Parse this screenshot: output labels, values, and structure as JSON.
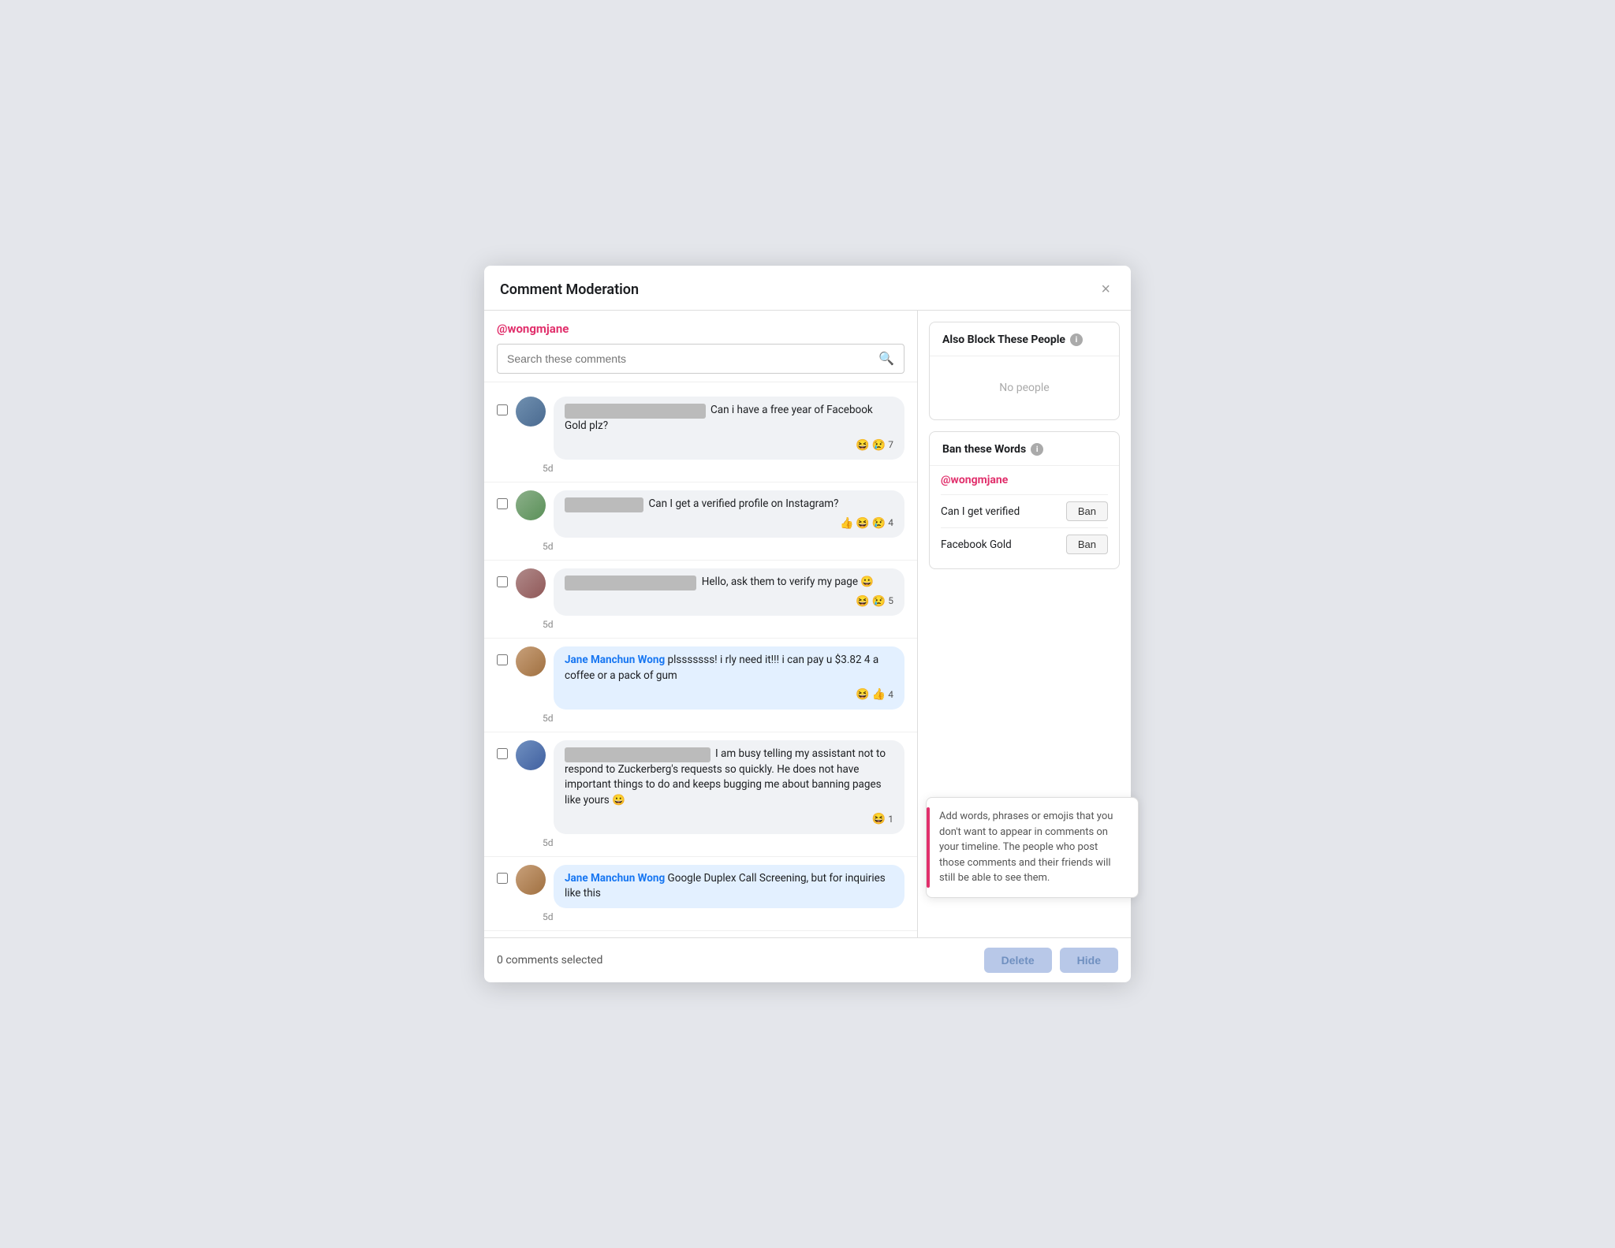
{
  "modal": {
    "title": "Comment Moderation",
    "close_label": "×"
  },
  "left": {
    "page_handle": "@wongmjane",
    "search_placeholder": "Search these comments",
    "comments": [
      {
        "id": 1,
        "blurred": true,
        "text": "Can i have a free year of Facebook Gold plz?",
        "reactions": [
          "😆",
          "😢"
        ],
        "reaction_count": 7,
        "time": "5d"
      },
      {
        "id": 2,
        "blurred": true,
        "text": "Can I get a verified profile on Instagram?",
        "reactions": [
          "👍",
          "😆",
          "😢"
        ],
        "reaction_count": 4,
        "time": "5d"
      },
      {
        "id": 3,
        "blurred": true,
        "text": "Hello, ask them to verify my page 😀",
        "reactions": [
          "😆",
          "😢"
        ],
        "reaction_count": 5,
        "time": "5d"
      },
      {
        "id": 4,
        "blurred": false,
        "name": "Jane Manchun Wong",
        "text": "plsssssss! i rly need it!!! i can pay u $3.82 4 a coffee or a pack of gum",
        "reactions": [
          "😆",
          "👍"
        ],
        "reaction_count": 4,
        "time": "5d"
      },
      {
        "id": 5,
        "blurred": true,
        "text": "I am busy telling my assistant not to respond to Zuckerberg's requests so quickly. He does not have important things to do and keeps bugging me about banning pages like yours 😀",
        "reactions": [
          "😆"
        ],
        "reaction_count": 1,
        "time": "5d"
      },
      {
        "id": 6,
        "blurred": false,
        "name": "Jane Manchun Wong",
        "text": "Google Duplex Call Screening, but for inquiries like this",
        "reactions": [],
        "reaction_count": 0,
        "time": "5d"
      }
    ]
  },
  "right": {
    "also_block": {
      "header": "Also Block These People",
      "no_people": "No people"
    },
    "ban_words": {
      "header": "Ban these Words",
      "handle": "@wongmjane",
      "words": [
        {
          "word": "Can I get verified",
          "btn": "Ban"
        },
        {
          "word": "Facebook Gold",
          "btn": "Ban"
        }
      ]
    },
    "tooltip": {
      "text": "Add words, phrases or emojis that you don't want to appear in comments on your timeline. The people who post those comments and their friends will still be able to see them."
    }
  },
  "footer": {
    "selected_label": "0 comments selected",
    "delete_label": "Delete",
    "hide_label": "Hide"
  },
  "icons": {
    "search": "🔍",
    "info": "i"
  }
}
